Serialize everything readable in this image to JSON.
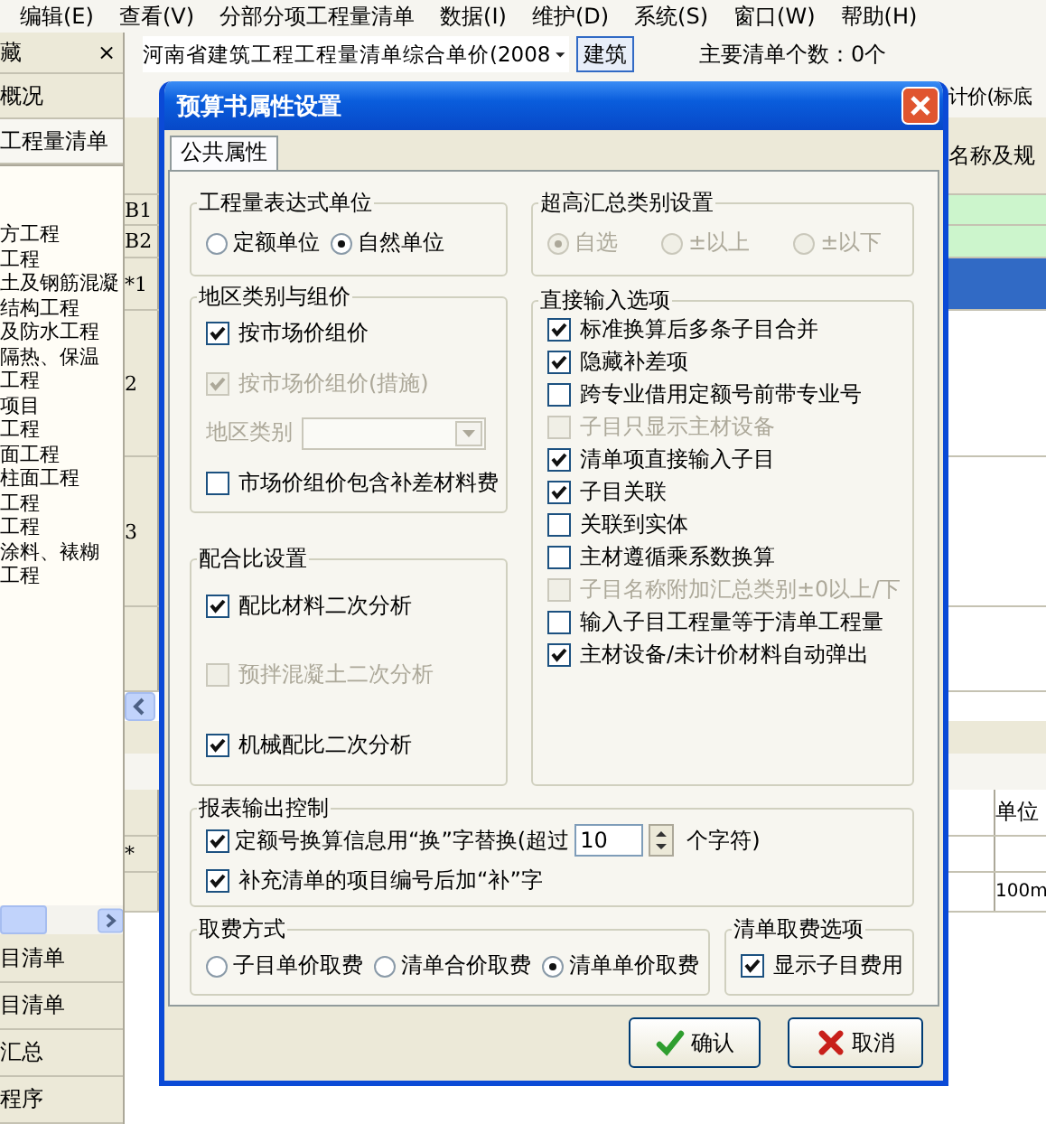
{
  "menu_bar": [
    "编辑(E)",
    "查看(V)",
    "分部分项工程量清单",
    "数据(I)",
    "维护(D)",
    "系统(S)",
    "窗口(W)",
    "帮助(H)"
  ],
  "side_panel": {
    "title": "藏",
    "close": "×",
    "tabs": [
      {
        "label": "概况",
        "selected": false
      },
      {
        "label": "工程量清单",
        "selected": true
      }
    ],
    "tree": [
      "方工程",
      "工程",
      "土及钢筋混凝",
      "结构工程",
      "及防水工程",
      "隔热、保温",
      "工程",
      "项目",
      "工程",
      "面工程",
      "柱面工程",
      "工程",
      "工程",
      "涂料、裱糊",
      "工程"
    ],
    "bottom_items": [
      "目清单",
      "目清单",
      "汇总",
      "程序"
    ]
  },
  "toolbar": {
    "norm": "河南省建筑工程工程量清单综合单价(2008",
    "profession": "建筑",
    "count": "主要清单个数：0个"
  },
  "grid": {
    "caption": "计价(标底",
    "header": "名称及规",
    "rows": [
      {
        "label": "B1",
        "kind": "supplement",
        "selected": false
      },
      {
        "label": "B2",
        "kind": "supplement",
        "selected": false
      },
      {
        "label": "*1",
        "selected": true
      },
      {
        "label": "2",
        "kind": "item",
        "selected": false
      },
      {
        "label": "3",
        "kind": "item",
        "selected": false
      }
    ]
  },
  "lower_grid": {
    "header": "单位",
    "rows": [
      {
        "label": "*"
      },
      {
        "unit": "100m"
      }
    ]
  },
  "dialog": {
    "title": "预算书属性设置",
    "tabs": [
      {
        "label": "公共属性",
        "selected": true
      }
    ],
    "left_column": [
      {
        "title": "工程量表达式单位",
        "items": [
          {
            "kind": "radios",
            "disabled": false,
            "options": [
              {
                "label": "定额单位",
                "selected": false
              },
              {
                "label": "自然单位",
                "selected": true
              }
            ]
          }
        ]
      },
      {
        "title": "地区类别与组价",
        "items": [
          {
            "kind": "checkbox",
            "label": "按市场价组价",
            "checked": true,
            "disabled": false
          },
          {
            "kind": "checkbox",
            "label": "按市场价组价(措施)",
            "checked": true,
            "disabled": true
          },
          {
            "kind": "combo",
            "label": "地区类别",
            "disabled": true
          },
          {
            "kind": "checkbox",
            "label": "市场价组价包含补差材料费",
            "checked": false,
            "disabled": false
          }
        ]
      },
      {
        "title": "配合比设置",
        "items": [
          {
            "kind": "checkbox",
            "label": "配比材料二次分析",
            "checked": true,
            "disabled": false
          },
          {
            "kind": "checkbox",
            "label": "预拌混凝土二次分析",
            "checked": false,
            "disabled": true
          },
          {
            "kind": "checkbox",
            "label": "机械配比二次分析",
            "checked": true,
            "disabled": false
          }
        ]
      }
    ],
    "right_column": [
      {
        "title": "超高汇总类别设置",
        "items": [
          {
            "kind": "radios",
            "disabled": true,
            "options": [
              {
                "label": "自选",
                "selected": true
              },
              {
                "label": "±以上",
                "selected": false
              },
              {
                "label": "±以下",
                "selected": false
              }
            ]
          }
        ]
      },
      {
        "title": "直接输入选项",
        "items": [
          {
            "kind": "checkbox",
            "label": "标准换算后多条子目合并",
            "checked": true,
            "disabled": false
          },
          {
            "kind": "checkbox",
            "label": "隐藏补差项",
            "checked": true,
            "disabled": false
          },
          {
            "kind": "checkbox",
            "label": "跨专业借用定额号前带专业号",
            "checked": false,
            "disabled": false
          },
          {
            "kind": "checkbox",
            "label": "子目只显示主材设备",
            "checked": false,
            "disabled": true
          },
          {
            "kind": "checkbox",
            "label": "清单项直接输入子目",
            "checked": true,
            "disabled": false
          },
          {
            "kind": "checkbox",
            "label": "子目关联",
            "checked": true,
            "disabled": false
          },
          {
            "kind": "checkbox",
            "label": "关联到实体",
            "checked": false,
            "disabled": false
          },
          {
            "kind": "checkbox",
            "label": "主材遵循乘系数换算",
            "checked": false,
            "disabled": false
          },
          {
            "kind": "checkbox",
            "label": "子目名称附加汇总类别±0以上/下",
            "checked": false,
            "disabled": true
          },
          {
            "kind": "checkbox",
            "label": "输入子目工程量等于清单工程量",
            "checked": false,
            "disabled": false
          },
          {
            "kind": "checkbox",
            "label": "主材设备/未计价材料自动弹出",
            "checked": true,
            "disabled": false
          }
        ]
      }
    ],
    "report_group": {
      "title": "报表输出控制",
      "items": [
        {
          "kind": "checkbox_spin",
          "label": "定额号换算信息用“换”字替换(超过",
          "value": "10",
          "suffix": "个字符)",
          "checked": true,
          "disabled": false
        },
        {
          "kind": "checkbox",
          "label": "补充清单的项目编号后加“补”字",
          "checked": true,
          "disabled": false
        }
      ]
    },
    "bottom_row": [
      {
        "title": "取费方式",
        "items": [
          {
            "kind": "radios",
            "disabled": false,
            "options": [
              {
                "label": "子目单价取费",
                "selected": false
              },
              {
                "label": "清单合价取费",
                "selected": false
              },
              {
                "label": "清单单价取费",
                "selected": true
              }
            ]
          }
        ]
      },
      {
        "title": "清单取费选项",
        "items": [
          {
            "kind": "checkbox",
            "label": "显示子目费用",
            "checked": true,
            "disabled": false
          }
        ]
      }
    ],
    "buttons": [
      {
        "label": "确认",
        "kind": "ok"
      },
      {
        "label": "取消",
        "kind": "cancel"
      }
    ]
  }
}
